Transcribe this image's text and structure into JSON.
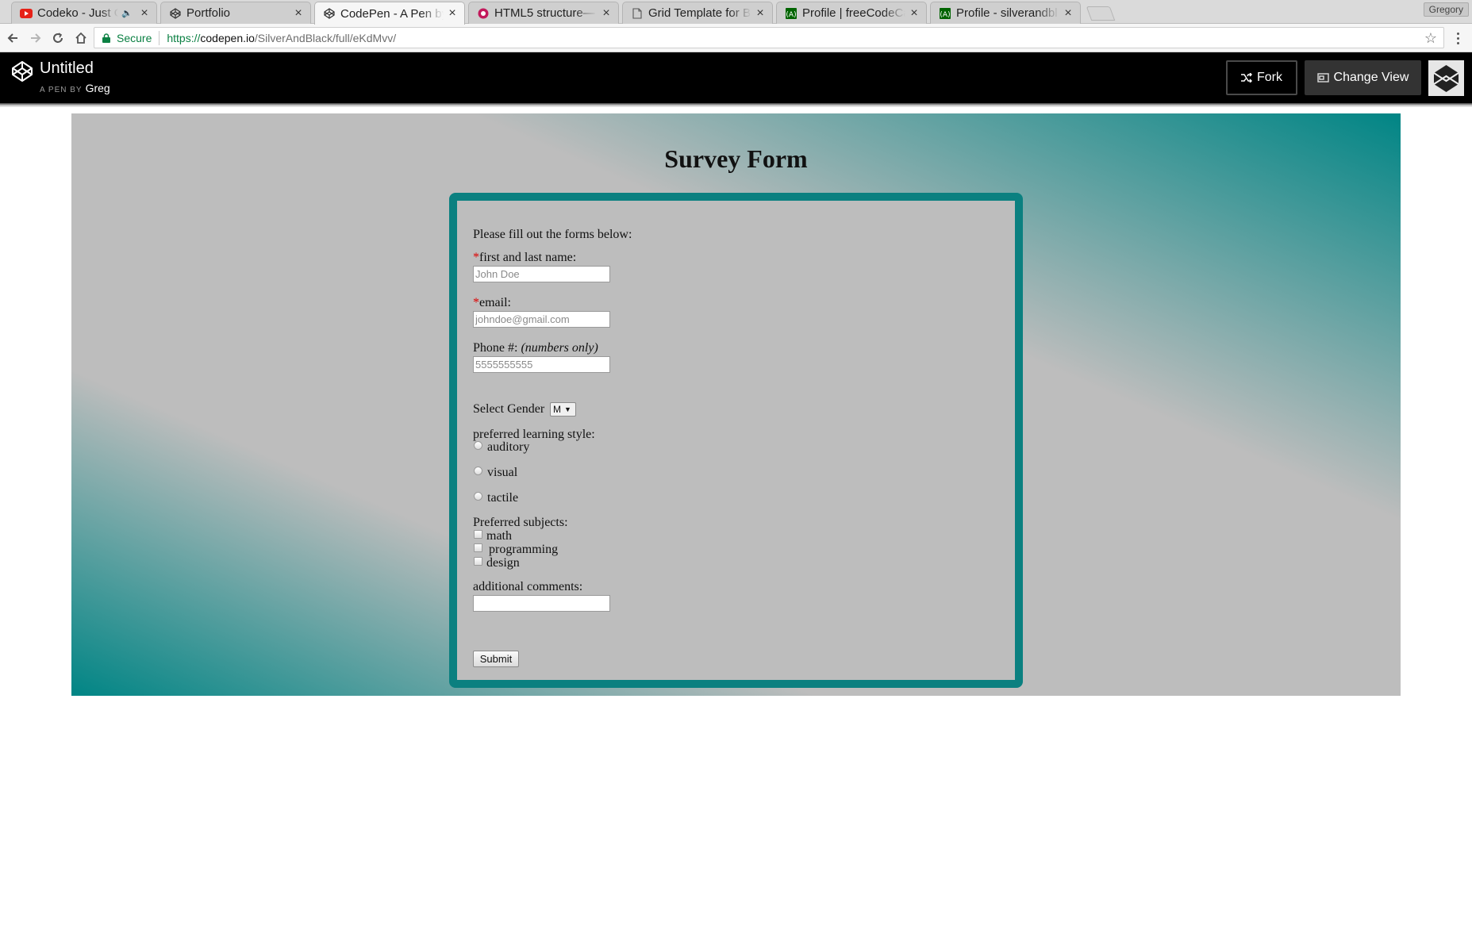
{
  "browser": {
    "tabs": [
      {
        "title": "Codeko - Just Go",
        "icon": "youtube-icon",
        "muted": true
      },
      {
        "title": "Portfolio",
        "icon": "codepen-icon"
      },
      {
        "title": "CodePen - A Pen by",
        "icon": "codepen-icon",
        "active": true
      },
      {
        "title": "HTML5 structure—",
        "icon": "html5-icon"
      },
      {
        "title": "Grid Template for B",
        "icon": "document-icon"
      },
      {
        "title": "Profile | freeCodeCa",
        "icon": "freecodecamp-icon"
      },
      {
        "title": "Profile - silverandbl",
        "icon": "freecodecamp-icon"
      }
    ],
    "profile_name": "Gregory",
    "security_label": "Secure",
    "url": {
      "scheme": "https://",
      "host": "codepen.io",
      "path": "/SilverAndBlack/full/eKdMvv/"
    }
  },
  "codepen": {
    "pen_title": "Untitled",
    "byline_prefix": "A PEN BY",
    "author": "Greg",
    "fork_label": "Fork",
    "change_view_label": "Change View"
  },
  "survey": {
    "heading": "Survey Form",
    "intro": "Please fill out the forms below:",
    "name_label": "first and last name:",
    "name_placeholder": "John Doe",
    "email_label": "email:",
    "email_placeholder": "johndoe@gmail.com",
    "phone_label": "Phone #:",
    "phone_hint": "(numbers only)",
    "phone_placeholder": "5555555555",
    "gender_label": "Select Gender",
    "gender_selected": "M",
    "learning_label": "preferred learning style:",
    "learning_options": [
      "auditory",
      "visual",
      "tactile"
    ],
    "subjects_label": "Preferred subjects:",
    "subjects": [
      "math",
      "programming",
      "design"
    ],
    "comments_label": "additional comments:",
    "submit_label": "Submit",
    "required_marker": "*"
  },
  "colors": {
    "accent_teal": "#008585",
    "form_border": "#0b8080",
    "form_background": "#bdbdbd",
    "required_red": "#dd0000"
  }
}
